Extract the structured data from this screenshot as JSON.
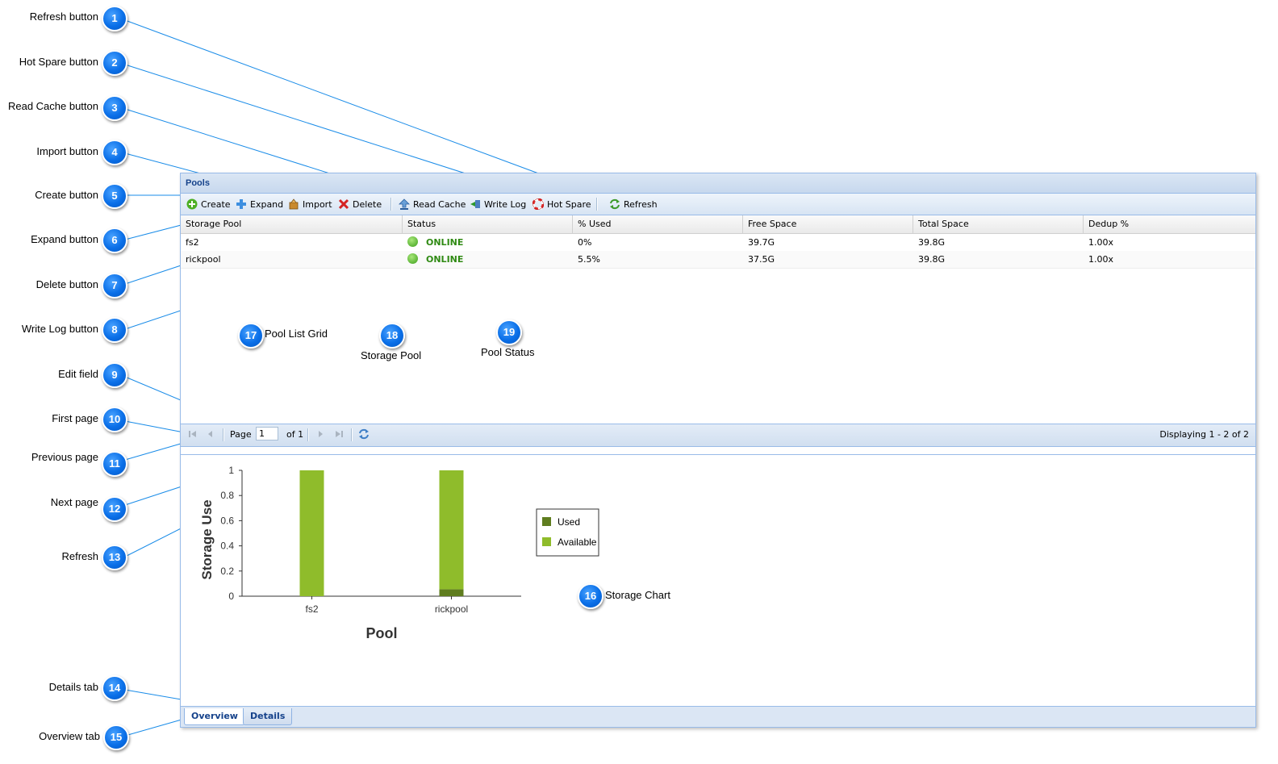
{
  "callouts": [
    {
      "n": "1",
      "label": "Refresh button"
    },
    {
      "n": "2",
      "label": "Hot Spare button"
    },
    {
      "n": "3",
      "label": "Read Cache button"
    },
    {
      "n": "4",
      "label": "Import button"
    },
    {
      "n": "5",
      "label": "Create button"
    },
    {
      "n": "6",
      "label": "Expand button"
    },
    {
      "n": "7",
      "label": "Delete button"
    },
    {
      "n": "8",
      "label": "Write Log button"
    },
    {
      "n": "9",
      "label": "Edit field"
    },
    {
      "n": "10",
      "label": "First page"
    },
    {
      "n": "11",
      "label": "Previous page"
    },
    {
      "n": "12",
      "label": "Next page"
    },
    {
      "n": "13",
      "label": "Refresh"
    },
    {
      "n": "14",
      "label": "Details tab"
    },
    {
      "n": "15",
      "label": "Overview tab"
    },
    {
      "n": "16",
      "label": "Storage Chart"
    },
    {
      "n": "17",
      "label": "Pool List Grid"
    },
    {
      "n": "18",
      "label": "Storage Pool"
    },
    {
      "n": "19",
      "label": "Pool Status"
    }
  ],
  "panel": {
    "title": "Pools"
  },
  "toolbar": {
    "create": "Create",
    "expand": "Expand",
    "import": "Import",
    "delete": "Delete",
    "read_cache": "Read Cache",
    "write_log": "Write Log",
    "hot_spare": "Hot Spare",
    "refresh": "Refresh"
  },
  "grid": {
    "columns": [
      "Storage Pool",
      "Status",
      "% Used",
      "Free Space",
      "Total Space",
      "Dedup %"
    ],
    "rows": [
      {
        "pool": "fs2",
        "status": "ONLINE",
        "used": "0%",
        "free": "39.7G",
        "total": "39.8G",
        "dedup": "1.00x"
      },
      {
        "pool": "rickpool",
        "status": "ONLINE",
        "used": "5.5%",
        "free": "37.5G",
        "total": "39.8G",
        "dedup": "1.00x"
      }
    ]
  },
  "pager": {
    "page_label": "Page",
    "page_value": "1",
    "of_label": "of 1",
    "displaying": "Displaying 1 - 2 of 2"
  },
  "chart_data": {
    "type": "bar",
    "stacked": true,
    "categories": [
      "fs2",
      "rickpool"
    ],
    "series": [
      {
        "name": "Used",
        "values": [
          0,
          0.055
        ],
        "color": "#5f7d1f"
      },
      {
        "name": "Available",
        "values": [
          1,
          0.945
        ],
        "color": "#8fbc2b"
      }
    ],
    "xlabel": "Pool",
    "ylabel": "Storage Use",
    "ylim": [
      0,
      1
    ],
    "yticks": [
      "0",
      "0.2",
      "0.4",
      "0.6",
      "0.8",
      "1"
    ],
    "legend": "right"
  },
  "tabs": {
    "overview": "Overview",
    "details": "Details"
  },
  "colors": {
    "callout": "#0a6fe8",
    "line": "#1a8ce8",
    "panel_border": "#99bbe8",
    "title": "#15428b"
  }
}
